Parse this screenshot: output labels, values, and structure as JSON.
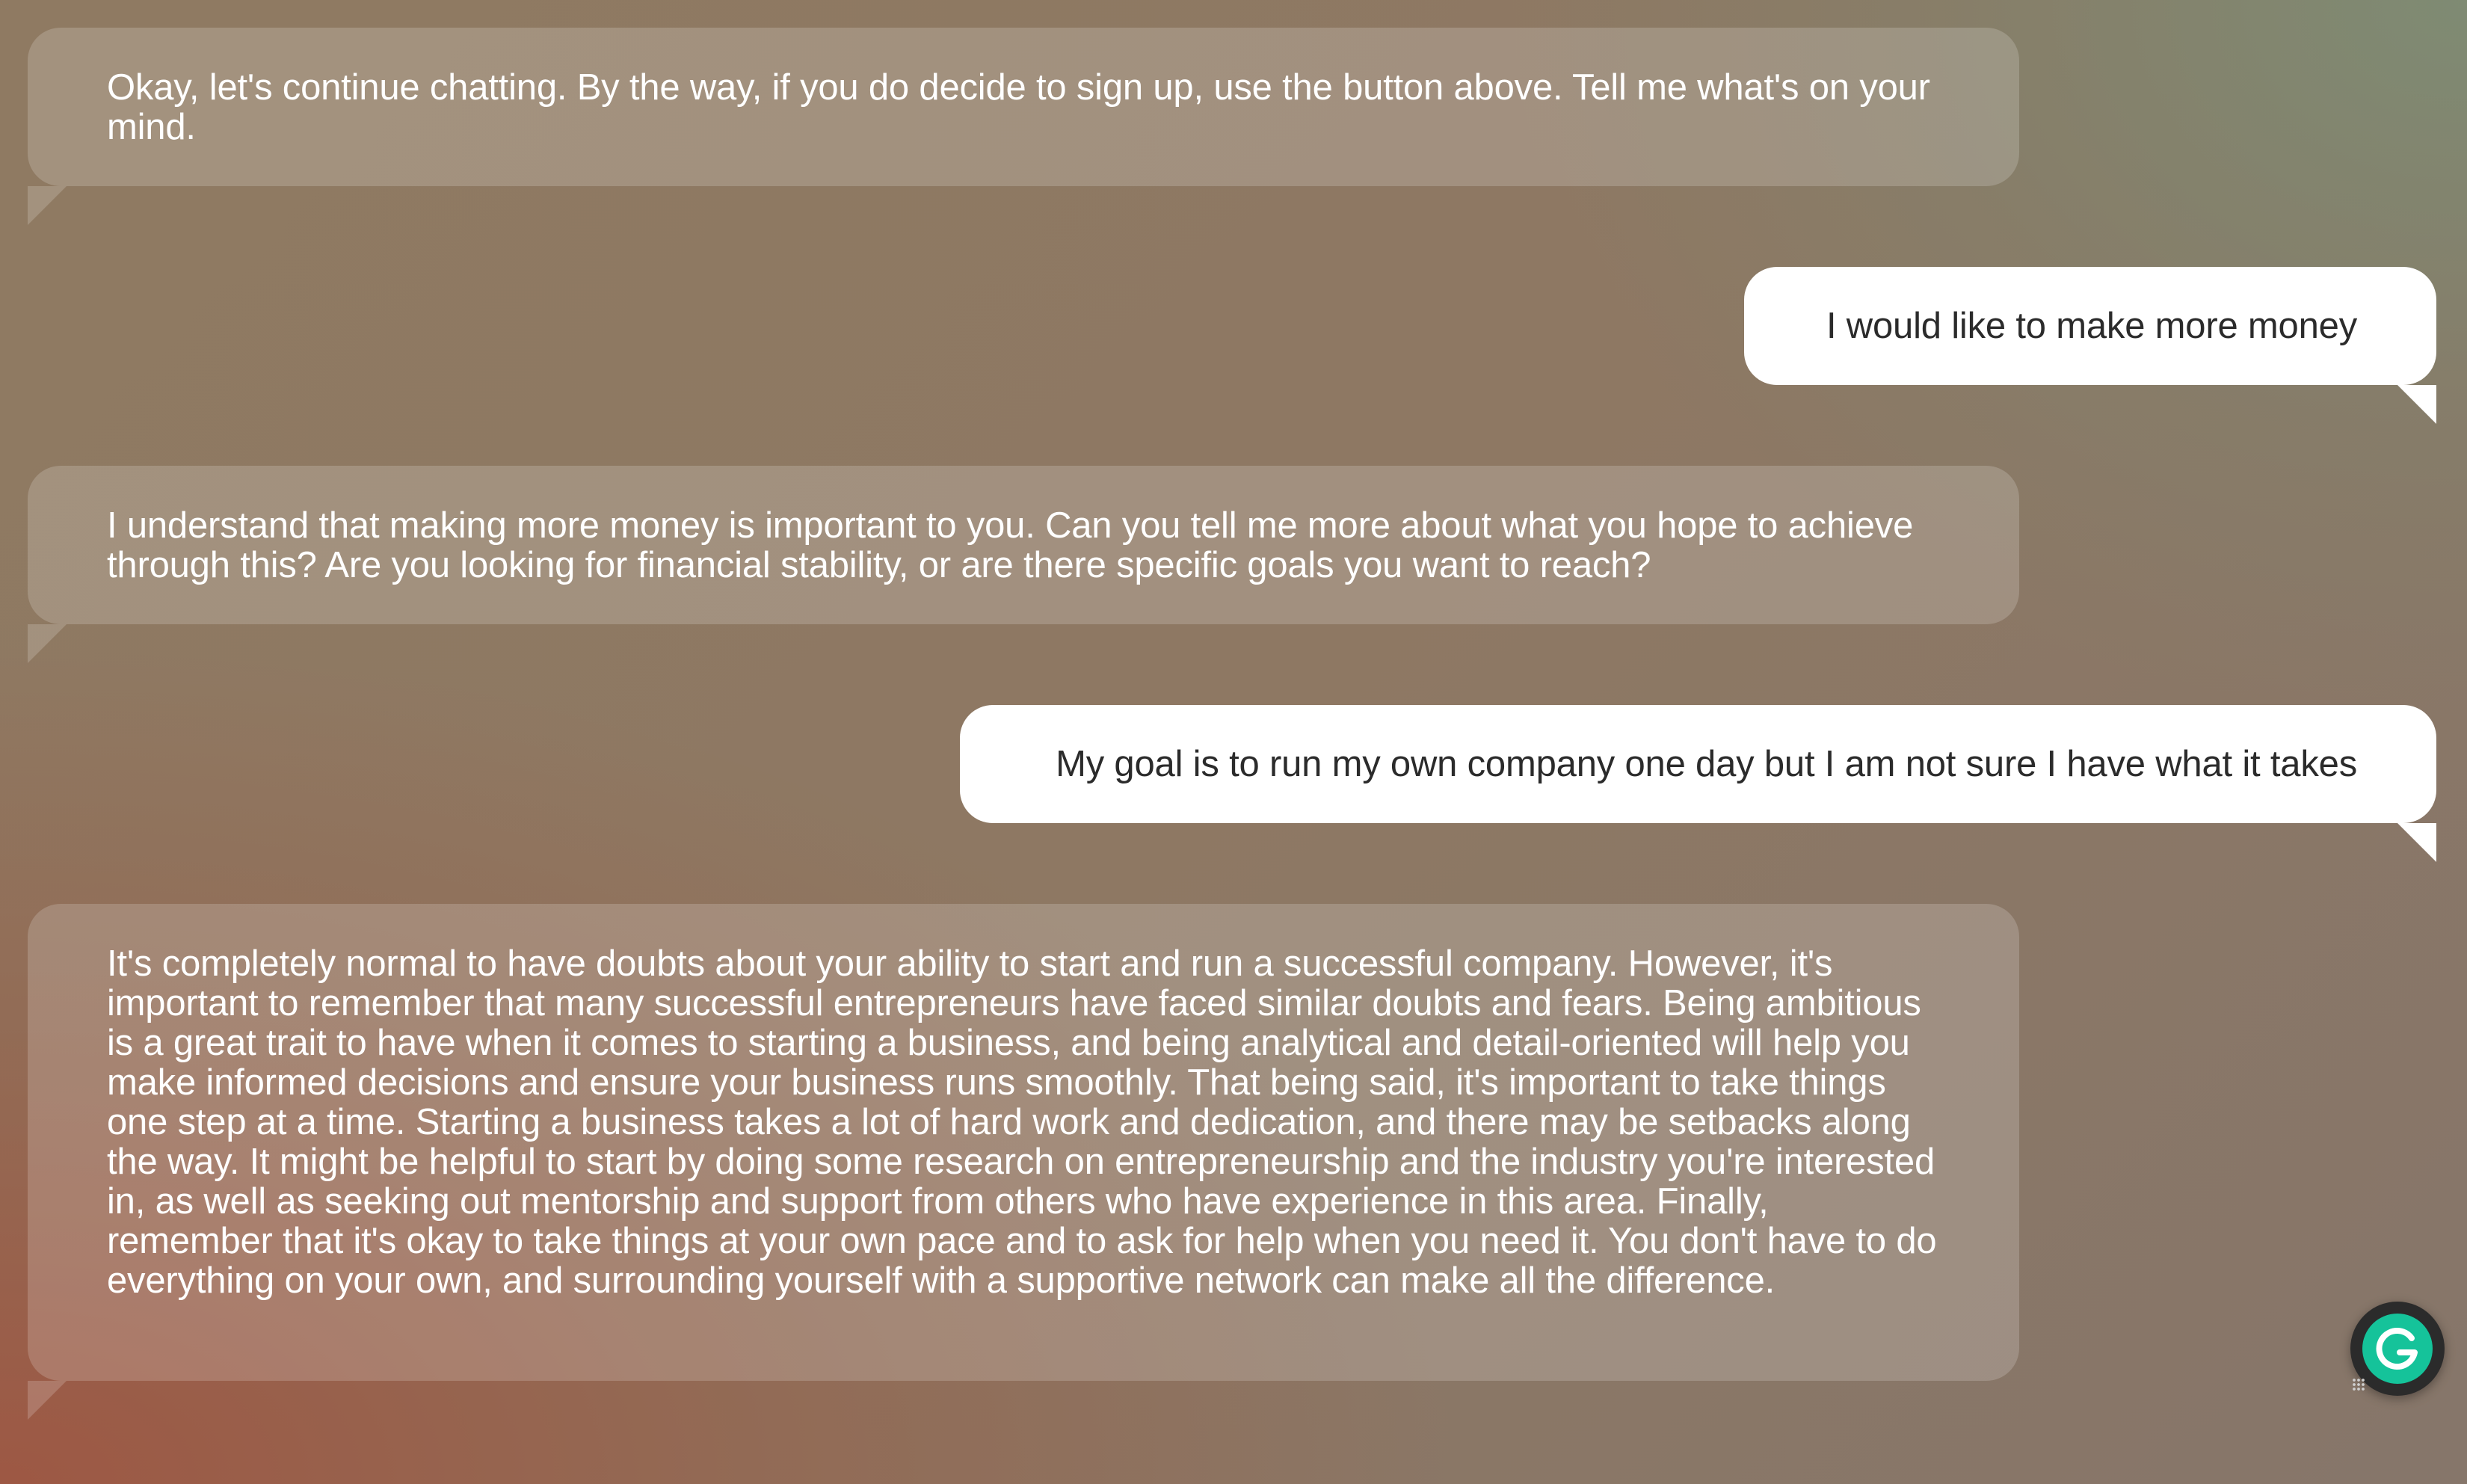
{
  "conversation": {
    "messages": [
      {
        "role": "assistant",
        "text": "Okay, let's continue chatting. By the way, if you do decide to sign up, use the button above. Tell me what's on your mind."
      },
      {
        "role": "user",
        "text": "I would like to make more money"
      },
      {
        "role": "assistant",
        "text": "I understand that making more money is important to you. Can you tell me more about what you hope to achieve through this? Are you looking for financial stability, or are there specific goals you want to reach?"
      },
      {
        "role": "user",
        "text": "My goal is to run my own company one day but I am not sure I have what it takes"
      },
      {
        "role": "assistant",
        "text": "It's completely normal to have doubts about your ability to start and run a successful company. However, it's important to remember that many successful entrepreneurs have faced similar doubts and fears. Being ambitious is a great trait to have when it comes to starting a business, and being analytical and detail-oriented will help you make informed decisions and ensure your business runs smoothly. That being said, it's important to take things one step at a time. Starting a business takes a lot of hard work and dedication, and there may be setbacks along the way. It might be helpful to start by doing some research on entrepreneurship and the industry you're interested in, as well as seeking out mentorship and support from others who have experience in this area. Finally, remember that it's okay to take things at your own pace and to ask for help when you need it. You don't have to do everything on your own, and surrounding yourself with a supportive network can make all the difference."
      }
    ]
  },
  "widgets": {
    "grammarly": {
      "icon": "grammarly-g-icon",
      "color": "#15c39a"
    }
  },
  "colors": {
    "assistant_bubble": "rgba(255,255,255,0.18)",
    "user_bubble": "#ffffff",
    "assistant_text": "#ffffff",
    "user_text": "#2b2b2b"
  }
}
